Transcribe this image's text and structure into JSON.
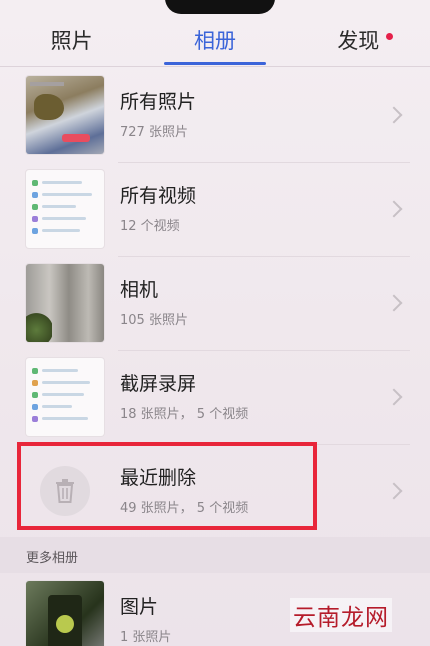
{
  "tabs": [
    {
      "label": "照片",
      "active": false
    },
    {
      "label": "相册",
      "active": true
    },
    {
      "label": "发现",
      "active": false,
      "badge": true
    }
  ],
  "albums": [
    {
      "title": "所有照片",
      "count": "727 张照片"
    },
    {
      "title": "所有视频",
      "count": "12 个视频"
    },
    {
      "title": "相机",
      "count": "105 张照片"
    },
    {
      "title": "截屏录屏",
      "count": "18 张照片， 5 个视频"
    },
    {
      "title": "最近删除",
      "count": "49 张照片， 5 个视频"
    }
  ],
  "more_section": {
    "header": "更多相册",
    "albums": [
      {
        "title": "图片",
        "count": "1 张照片"
      }
    ]
  },
  "watermark": "云南龙网",
  "colors": {
    "accent": "#3b64d9",
    "highlight": "#e8263a",
    "badge": "#e5204a"
  },
  "icons": {
    "recently_deleted": "trash-icon",
    "row_arrow": "chevron-right-icon"
  }
}
